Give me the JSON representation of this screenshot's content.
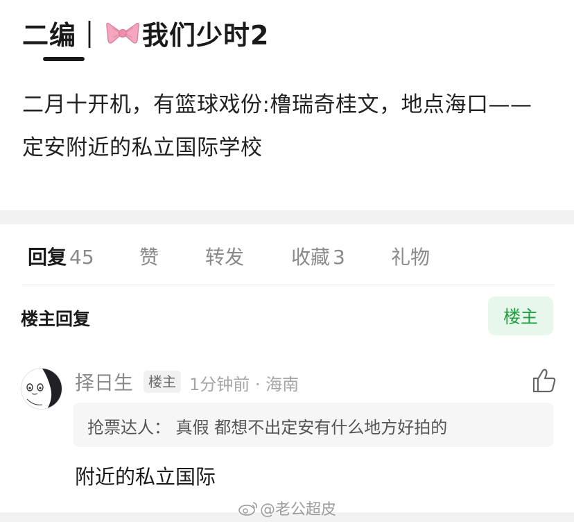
{
  "post": {
    "title_prefix": "二编｜",
    "title_suffix": "我们少时2",
    "bow_icon": "pink-bow-icon",
    "body": "二月十开机，有篮球戏份:橹瑞奇桂文，地点海口——定安附近的私立国际学校"
  },
  "tabs": [
    {
      "label": "回复",
      "count": "45",
      "active": true
    },
    {
      "label": "赞",
      "count": ""
    },
    {
      "label": "转发",
      "count": ""
    },
    {
      "label": "收藏",
      "count": "3"
    },
    {
      "label": "礼物",
      "count": ""
    }
  ],
  "filter": {
    "label": "楼主回复",
    "button": "楼主"
  },
  "comment": {
    "username": "择日生",
    "badge": "楼主",
    "meta": "1分钟前 · 海南",
    "quote": "抢票达人： 真假 都想不出定安有什么地方好拍的",
    "body": "附近的私立国际"
  },
  "watermark": {
    "text": "@老公超皮",
    "icon": "weibo-icon"
  },
  "colors": {
    "accent_green": "#1e9e3e",
    "accent_green_bg": "#e8f7ec",
    "separator": "#f2f2f2",
    "bow_pink": "#f4a6be"
  }
}
